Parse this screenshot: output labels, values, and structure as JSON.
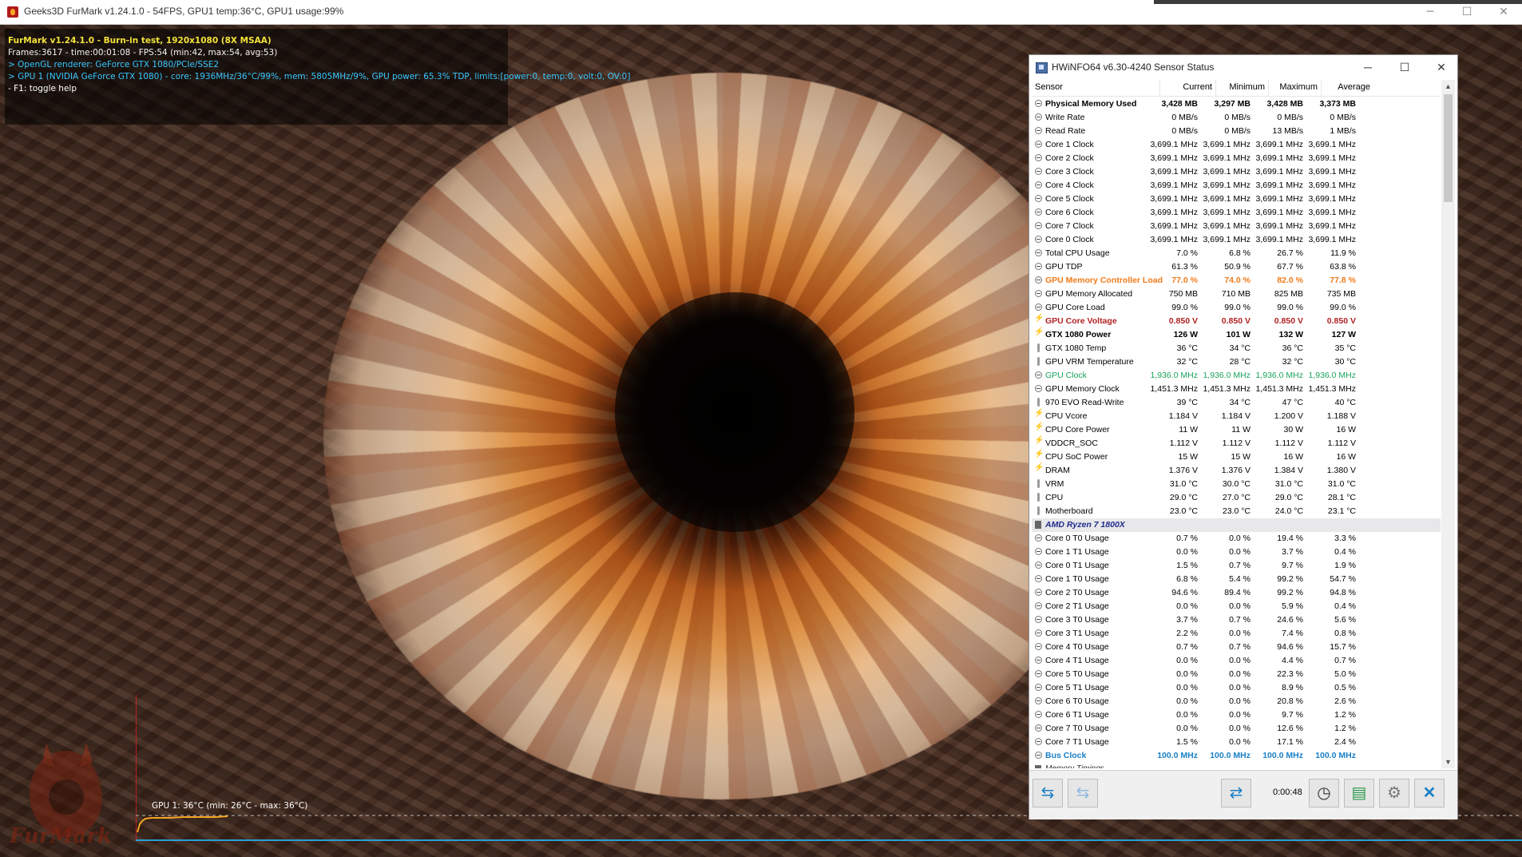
{
  "furmark": {
    "window_title": "Geeks3D FurMark v1.24.1.0 - 54FPS, GPU1 temp:36°C, GPU1 usage:99%",
    "overlay": [
      "FurMark v1.24.1.0 - Burn-in test, 1920x1080 (8X MSAA)",
      "Frames:3617 - time:00:01:08 - FPS:54 (min:42, max:54, avg:53)",
      "> OpenGL renderer: GeForce GTX 1080/PCIe/SSE2",
      "> GPU 1 (NVIDIA GeForce GTX 1080) - core: 1936MHz/36°C/99%, mem: 5805MHz/9%, GPU power: 65.3% TDP, limits:[power:0, temp:0, volt:0, OV:0]",
      "- F1: toggle help"
    ],
    "graph_label": "GPU 1: 36°C (min: 26°C - max: 36°C)",
    "logo_text": "FurMark",
    "colors": {
      "title_yellow": "#f2e33a",
      "info_cyan": "#38c8ff",
      "graph_orange": "#f6a623"
    }
  },
  "hwinfo": {
    "window_title": "HWiNFO64 v6.30-4240 Sensor Status",
    "columns": [
      "Sensor",
      "Current",
      "Minimum",
      "Maximum",
      "Average"
    ],
    "rows": [
      {
        "name": "Physical Memory Used",
        "cur": "3,428 MB",
        "min": "3,297 MB",
        "max": "3,428 MB",
        "avg": "3,373 MB",
        "style": "bold",
        "icon": "circle"
      },
      {
        "name": "Write Rate",
        "cur": "0 MB/s",
        "min": "0 MB/s",
        "max": "0 MB/s",
        "avg": "0 MB/s",
        "style": "",
        "icon": "circle"
      },
      {
        "name": "Read Rate",
        "cur": "0 MB/s",
        "min": "0 MB/s",
        "max": "13 MB/s",
        "avg": "1 MB/s",
        "style": "",
        "icon": "circle"
      },
      {
        "name": "Core 1 Clock",
        "cur": "3,699.1 MHz",
        "min": "3,699.1 MHz",
        "max": "3,699.1 MHz",
        "avg": "3,699.1 MHz",
        "style": "",
        "icon": "circle"
      },
      {
        "name": "Core 2 Clock",
        "cur": "3,699.1 MHz",
        "min": "3,699.1 MHz",
        "max": "3,699.1 MHz",
        "avg": "3,699.1 MHz",
        "style": "",
        "icon": "circle"
      },
      {
        "name": "Core 3 Clock",
        "cur": "3,699.1 MHz",
        "min": "3,699.1 MHz",
        "max": "3,699.1 MHz",
        "avg": "3,699.1 MHz",
        "style": "",
        "icon": "circle"
      },
      {
        "name": "Core 4 Clock",
        "cur": "3,699.1 MHz",
        "min": "3,699.1 MHz",
        "max": "3,699.1 MHz",
        "avg": "3,699.1 MHz",
        "style": "",
        "icon": "circle"
      },
      {
        "name": "Core 5 Clock",
        "cur": "3,699.1 MHz",
        "min": "3,699.1 MHz",
        "max": "3,699.1 MHz",
        "avg": "3,699.1 MHz",
        "style": "",
        "icon": "circle"
      },
      {
        "name": "Core 6 Clock",
        "cur": "3,699.1 MHz",
        "min": "3,699.1 MHz",
        "max": "3,699.1 MHz",
        "avg": "3,699.1 MHz",
        "style": "",
        "icon": "circle"
      },
      {
        "name": "Core 7 Clock",
        "cur": "3,699.1 MHz",
        "min": "3,699.1 MHz",
        "max": "3,699.1 MHz",
        "avg": "3,699.1 MHz",
        "style": "",
        "icon": "circle"
      },
      {
        "name": "Core 0 Clock",
        "cur": "3,699.1 MHz",
        "min": "3,699.1 MHz",
        "max": "3,699.1 MHz",
        "avg": "3,699.1 MHz",
        "style": "",
        "icon": "circle"
      },
      {
        "name": "Total CPU Usage",
        "cur": "7.0 %",
        "min": "6.8 %",
        "max": "26.7 %",
        "avg": "11.9 %",
        "style": "",
        "icon": "circle"
      },
      {
        "name": "GPU TDP",
        "cur": "61.3 %",
        "min": "50.9 %",
        "max": "67.7 %",
        "avg": "63.8 %",
        "style": "",
        "icon": "circle"
      },
      {
        "name": "GPU Memory Controller Load",
        "cur": "77.0 %",
        "min": "74.0 %",
        "max": "82.0 %",
        "avg": "77.8 %",
        "style": "orange",
        "icon": "circle"
      },
      {
        "name": "GPU Memory Allocated",
        "cur": "750 MB",
        "min": "710 MB",
        "max": "825 MB",
        "avg": "735 MB",
        "style": "",
        "icon": "circle"
      },
      {
        "name": "GPU Core Load",
        "cur": "99.0 %",
        "min": "99.0 %",
        "max": "99.0 %",
        "avg": "99.0 %",
        "style": "",
        "icon": "circle"
      },
      {
        "name": "GPU Core Voltage",
        "cur": "0.850 V",
        "min": "0.850 V",
        "max": "0.850 V",
        "avg": "0.850 V",
        "style": "red",
        "icon": "bolt"
      },
      {
        "name": "GTX 1080 Power",
        "cur": "126 W",
        "min": "101 W",
        "max": "132 W",
        "avg": "127 W",
        "style": "bold",
        "icon": "bolt"
      },
      {
        "name": "GTX 1080 Temp",
        "cur": "36 °C",
        "min": "34 °C",
        "max": "36 °C",
        "avg": "35 °C",
        "style": "",
        "icon": "therm"
      },
      {
        "name": "GPU VRM Temperature",
        "cur": "32 °C",
        "min": "28 °C",
        "max": "32 °C",
        "avg": "30 °C",
        "style": "",
        "icon": "therm"
      },
      {
        "name": "GPU Clock",
        "cur": "1,936.0 MHz",
        "min": "1,936.0 MHz",
        "max": "1,936.0 MHz",
        "avg": "1,936.0 MHz",
        "style": "green",
        "icon": "circle"
      },
      {
        "name": "GPU Memory Clock",
        "cur": "1,451.3 MHz",
        "min": "1,451.3 MHz",
        "max": "1,451.3 MHz",
        "avg": "1,451.3 MHz",
        "style": "",
        "icon": "circle"
      },
      {
        "name": "970 EVO Read-Write",
        "cur": "39 °C",
        "min": "34 °C",
        "max": "47 °C",
        "avg": "40 °C",
        "style": "",
        "icon": "therm"
      },
      {
        "name": "CPU Vcore",
        "cur": "1.184 V",
        "min": "1.184 V",
        "max": "1.200 V",
        "avg": "1.188 V",
        "style": "",
        "icon": "bolt"
      },
      {
        "name": "CPU Core Power",
        "cur": "11 W",
        "min": "11 W",
        "max": "30 W",
        "avg": "16 W",
        "style": "",
        "icon": "bolt"
      },
      {
        "name": "VDDCR_SOC",
        "cur": "1.112 V",
        "min": "1.112 V",
        "max": "1.112 V",
        "avg": "1.112 V",
        "style": "",
        "icon": "bolt"
      },
      {
        "name": "CPU SoC Power",
        "cur": "15 W",
        "min": "15 W",
        "max": "16 W",
        "avg": "16 W",
        "style": "",
        "icon": "bolt"
      },
      {
        "name": "DRAM",
        "cur": "1.376 V",
        "min": "1.376 V",
        "max": "1.384 V",
        "avg": "1.380 V",
        "style": "",
        "icon": "bolt"
      },
      {
        "name": "VRM",
        "cur": "31.0 °C",
        "min": "30.0 °C",
        "max": "31.0 °C",
        "avg": "31.0 °C",
        "style": "",
        "icon": "therm"
      },
      {
        "name": "CPU",
        "cur": "29.0 °C",
        "min": "27.0 °C",
        "max": "29.0 °C",
        "avg": "28.1 °C",
        "style": "",
        "icon": "therm"
      },
      {
        "name": "Motherboard",
        "cur": "23.0 °C",
        "min": "23.0 °C",
        "max": "24.0 °C",
        "avg": "23.1 °C",
        "style": "",
        "icon": "therm"
      },
      {
        "name": "AMD Ryzen 7 1800X",
        "cur": "",
        "min": "",
        "max": "",
        "avg": "",
        "style": "section",
        "icon": "chip"
      },
      {
        "name": "Core 0 T0 Usage",
        "cur": "0.7 %",
        "min": "0.0 %",
        "max": "19.4 %",
        "avg": "3.3 %",
        "style": "",
        "icon": "circle"
      },
      {
        "name": "Core 1 T1 Usage",
        "cur": "0.0 %",
        "min": "0.0 %",
        "max": "3.7 %",
        "avg": "0.4 %",
        "style": "",
        "icon": "circle"
      },
      {
        "name": "Core 0 T1 Usage",
        "cur": "1.5 %",
        "min": "0.7 %",
        "max": "9.7 %",
        "avg": "1.9 %",
        "style": "",
        "icon": "circle"
      },
      {
        "name": "Core 1 T0 Usage",
        "cur": "6.8 %",
        "min": "5.4 %",
        "max": "99.2 %",
        "avg": "54.7 %",
        "style": "",
        "icon": "circle"
      },
      {
        "name": "Core 2 T0 Usage",
        "cur": "94.6 %",
        "min": "89.4 %",
        "max": "99.2 %",
        "avg": "94.8 %",
        "style": "",
        "icon": "circle"
      },
      {
        "name": "Core 2 T1 Usage",
        "cur": "0.0 %",
        "min": "0.0 %",
        "max": "5.9 %",
        "avg": "0.4 %",
        "style": "",
        "icon": "circle"
      },
      {
        "name": "Core 3 T0 Usage",
        "cur": "3.7 %",
        "min": "0.7 %",
        "max": "24.6 %",
        "avg": "5.6 %",
        "style": "",
        "icon": "circle"
      },
      {
        "name": "Core 3 T1 Usage",
        "cur": "2.2 %",
        "min": "0.0 %",
        "max": "7.4 %",
        "avg": "0.8 %",
        "style": "",
        "icon": "circle"
      },
      {
        "name": "Core 4 T0 Usage",
        "cur": "0.7 %",
        "min": "0.7 %",
        "max": "94.6 %",
        "avg": "15.7 %",
        "style": "",
        "icon": "circle"
      },
      {
        "name": "Core 4 T1 Usage",
        "cur": "0.0 %",
        "min": "0.0 %",
        "max": "4.4 %",
        "avg": "0.7 %",
        "style": "",
        "icon": "circle"
      },
      {
        "name": "Core 5 T0 Usage",
        "cur": "0.0 %",
        "min": "0.0 %",
        "max": "22.3 %",
        "avg": "5.0 %",
        "style": "",
        "icon": "circle"
      },
      {
        "name": "Core 5 T1 Usage",
        "cur": "0.0 %",
        "min": "0.0 %",
        "max": "8.9 %",
        "avg": "0.5 %",
        "style": "",
        "icon": "circle"
      },
      {
        "name": "Core 6 T0 Usage",
        "cur": "0.0 %",
        "min": "0.0 %",
        "max": "20.8 %",
        "avg": "2.6 %",
        "style": "",
        "icon": "circle"
      },
      {
        "name": "Core 6 T1 Usage",
        "cur": "0.0 %",
        "min": "0.0 %",
        "max": "9.7 %",
        "avg": "1.2 %",
        "style": "",
        "icon": "circle"
      },
      {
        "name": "Core 7 T0 Usage",
        "cur": "0.0 %",
        "min": "0.0 %",
        "max": "12.6 %",
        "avg": "1.2 %",
        "style": "",
        "icon": "circle"
      },
      {
        "name": "Core 7 T1 Usage",
        "cur": "1.5 %",
        "min": "0.0 %",
        "max": "17.1 %",
        "avg": "2.4 %",
        "style": "",
        "icon": "circle"
      },
      {
        "name": "Bus Clock",
        "cur": "100.0 MHz",
        "min": "100.0 MHz",
        "max": "100.0 MHz",
        "avg": "100.0 MHz",
        "style": "blue",
        "icon": "circle"
      },
      {
        "name": "Memory Timings",
        "cur": "",
        "min": "",
        "max": "",
        "avg": "",
        "style": "sub",
        "icon": "chip"
      }
    ],
    "timer": "0:00:48"
  }
}
